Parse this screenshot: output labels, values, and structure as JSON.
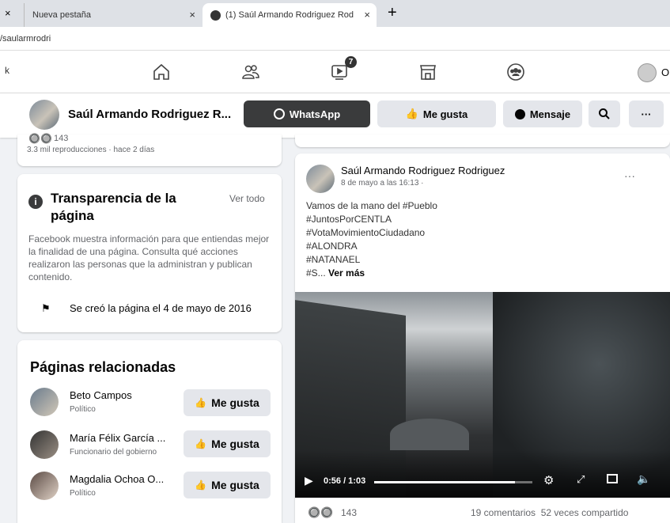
{
  "browser": {
    "tabs": [
      {
        "label": "Nueva pestaña"
      },
      {
        "label": "(1) Saúl Armando Rodriguez Rod"
      }
    ],
    "new_tab_symbol": "+",
    "close_symbol": "×",
    "address": "/saularmrodri"
  },
  "topnav": {
    "left_fragment": "k",
    "watch_badge": "7",
    "right_fragment": "O"
  },
  "page_header": {
    "page_name": "Saúl Armando Rodriguez R...",
    "whatsapp_label": "WhatsApp",
    "like_label": "Me gusta",
    "message_label": "Mensaje",
    "more_label": "···"
  },
  "left_top": {
    "views": "3.3 mil reproducciones · hace 2 días",
    "reaction_count": "143"
  },
  "transparency": {
    "title": "Transparencia de la página",
    "see_all": "Ver todo",
    "description": "Facebook muestra información para que entiendas mejor la finalidad de una página. Consulta qué acciones realizaron las personas que la administran y publican contenido.",
    "created": "Se creó la página el 4 de mayo de 2016"
  },
  "related": {
    "title": "Páginas relacionadas",
    "like_label": "Me gusta",
    "items": [
      {
        "name": "Beto Campos",
        "category": "Político"
      },
      {
        "name": "María Félix García ...",
        "category": "Funcionario del gobierno"
      },
      {
        "name": "Magdalia Ochoa O...",
        "category": "Político"
      }
    ]
  },
  "post": {
    "author": "Saúl Armando Rodriguez Rodriguez",
    "meta": "8 de mayo a las 16:13 ·",
    "more": "···",
    "lines": [
      "Vamos de la mano del #Pueblo",
      "#JuntosPorCENTLA",
      "#VotaMovimientoCiudadano",
      "#ALONDRA",
      "#NATANAEL",
      "#S..."
    ],
    "see_more": "Ver más",
    "video_time": "0:56 / 1:03",
    "video_progress": 0.89,
    "reactions": "143",
    "stats": "19 comentarios  52 veces compartido"
  },
  "colors": {
    "whatsapp_bg": "#3a3b3c",
    "gray_button": "#e4e6eb",
    "facebook_blue": "#1877f2"
  }
}
